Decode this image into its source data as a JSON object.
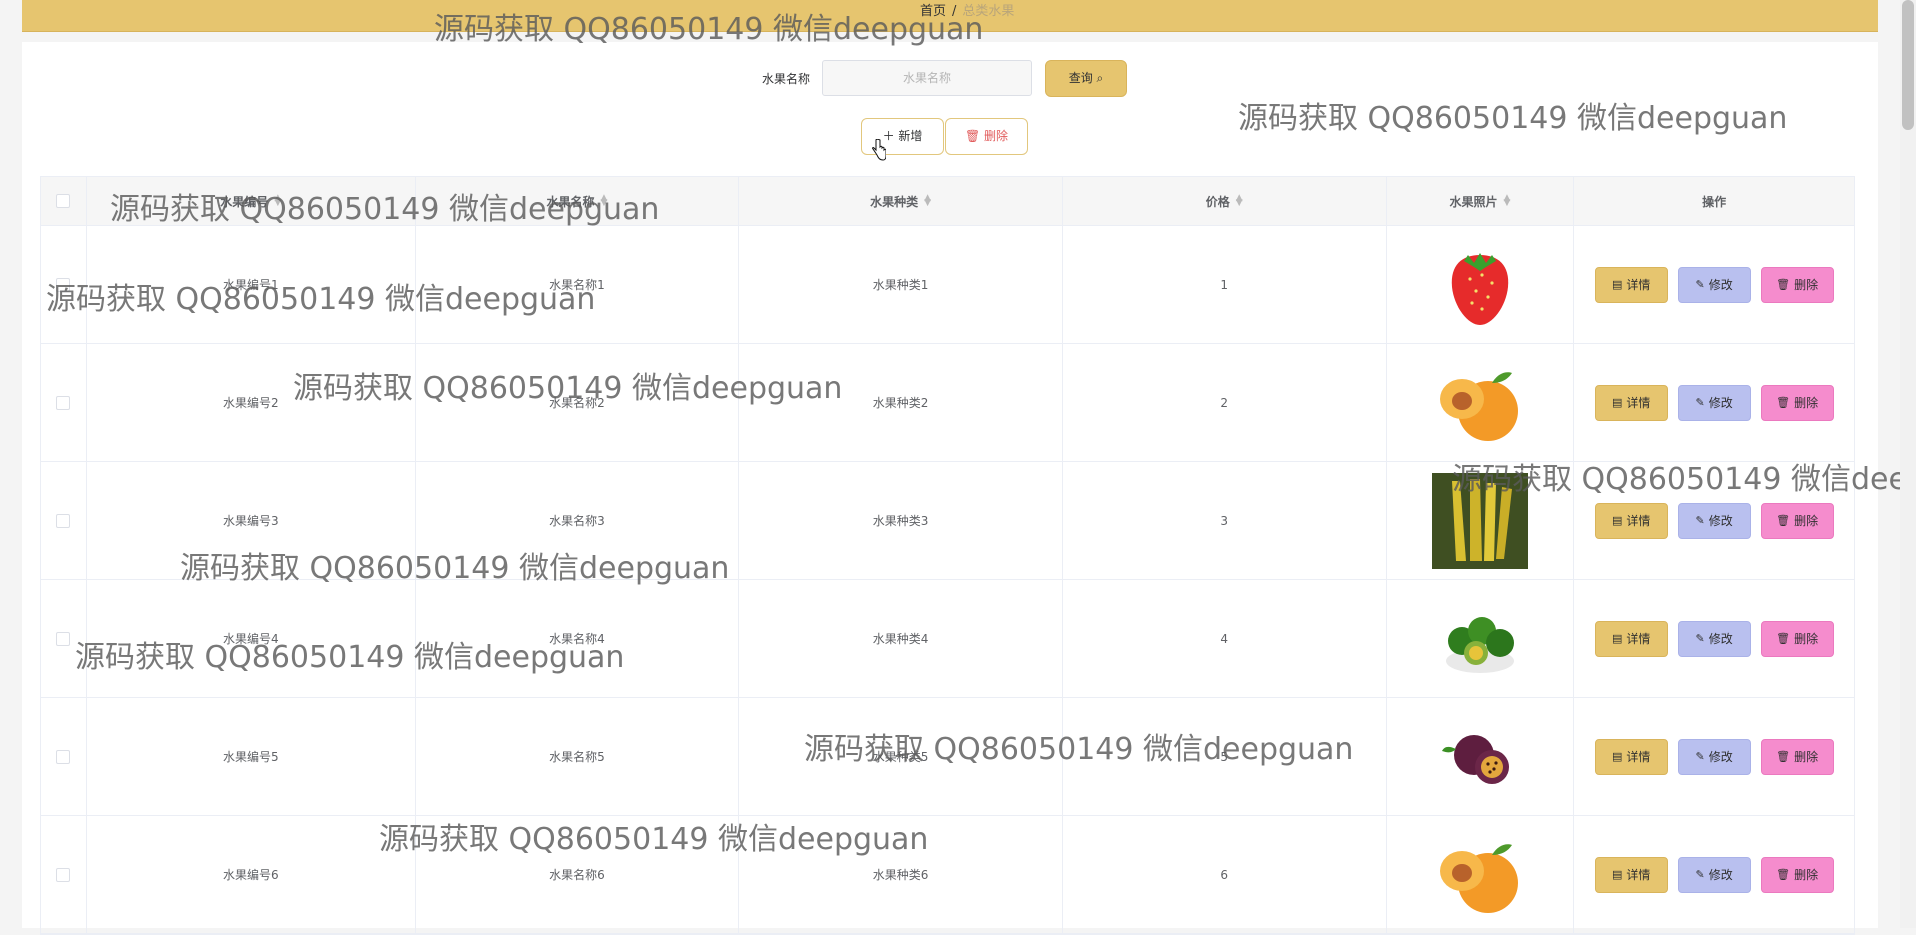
{
  "breadcrumb": {
    "home": "首页",
    "separator": "/",
    "current": "总类水果"
  },
  "search": {
    "label": "水果名称",
    "placeholder": "水果名称",
    "button": "查询"
  },
  "toolbar": {
    "add": "新增",
    "delete": "删除"
  },
  "table": {
    "headers": [
      "水果编号",
      "水果名称",
      "水果种类",
      "价格",
      "水果照片",
      "操作"
    ],
    "rows": [
      {
        "no": "水果编号1",
        "name": "水果名称1",
        "type": "水果种类1",
        "price": "1",
        "photo": "strawberry"
      },
      {
        "no": "水果编号2",
        "name": "水果名称2",
        "type": "水果种类2",
        "price": "2",
        "photo": "apricot"
      },
      {
        "no": "水果编号3",
        "name": "水果名称3",
        "type": "水果种类3",
        "price": "3",
        "photo": "starfruit"
      },
      {
        "no": "水果编号4",
        "name": "水果名称4",
        "type": "水果种类4",
        "price": "4",
        "photo": "lime"
      },
      {
        "no": "水果编号5",
        "name": "水果名称5",
        "type": "水果种类5",
        "price": "5",
        "photo": "passionfruit"
      },
      {
        "no": "水果编号6",
        "name": "水果名称6",
        "type": "水果种类6",
        "price": "6",
        "photo": "apricot"
      }
    ],
    "actions": {
      "detail": "详情",
      "edit": "修改",
      "delete": "删除"
    }
  },
  "watermark": "源码获取 QQ86050149 微信deepguan",
  "watermark_short": "源码获取 QQ86050149 微信deep",
  "colors": {
    "accent": "#e6c56f",
    "edit": "#b9c0ef",
    "delete": "#f58ccd"
  }
}
